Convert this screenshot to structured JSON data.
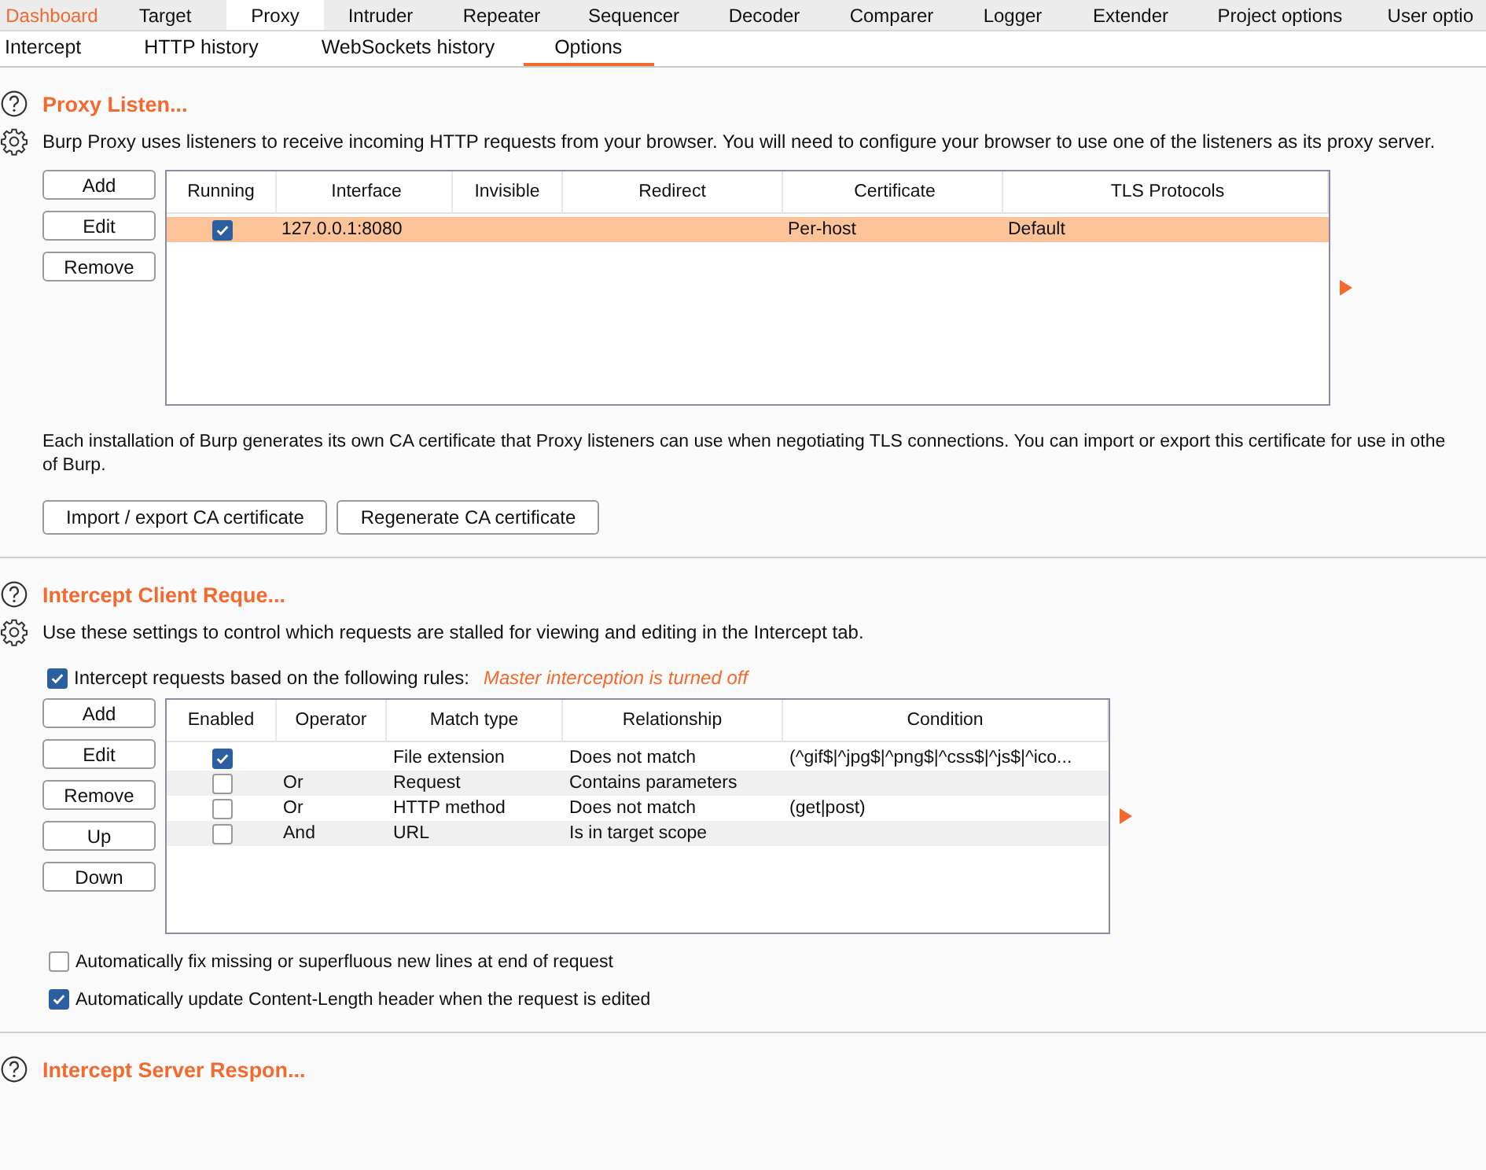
{
  "main_tabs": [
    {
      "label": "Dashboard",
      "selected": false,
      "highlight": true
    },
    {
      "label": "Target",
      "selected": false,
      "highlight": false
    },
    {
      "label": "Proxy",
      "selected": true,
      "highlight": false
    },
    {
      "label": "Intruder",
      "selected": false,
      "highlight": false
    },
    {
      "label": "Repeater",
      "selected": false,
      "highlight": false
    },
    {
      "label": "Sequencer",
      "selected": false,
      "highlight": false
    },
    {
      "label": "Decoder",
      "selected": false,
      "highlight": false
    },
    {
      "label": "Comparer",
      "selected": false,
      "highlight": false
    },
    {
      "label": "Logger",
      "selected": false,
      "highlight": false
    },
    {
      "label": "Extender",
      "selected": false,
      "highlight": false
    },
    {
      "label": "Project options",
      "selected": false,
      "highlight": false
    },
    {
      "label": "User optio",
      "selected": false,
      "highlight": false
    }
  ],
  "sub_tabs": [
    {
      "label": "Intercept",
      "selected": false
    },
    {
      "label": "HTTP history",
      "selected": false
    },
    {
      "label": "WebSockets history",
      "selected": false
    },
    {
      "label": "Options",
      "selected": true
    }
  ],
  "proxy_listeners": {
    "title": "Proxy Listen...",
    "description": "Burp Proxy uses listeners to receive incoming HTTP requests from your browser. You will need to configure your browser to use one of the listeners as its proxy server.",
    "buttons": [
      "Add",
      "Edit",
      "Remove"
    ],
    "columns": [
      "Running",
      "Interface",
      "Invisible",
      "Redirect",
      "Certificate",
      "TLS Protocols"
    ],
    "rows": [
      {
        "running": true,
        "interface": "127.0.0.1:8080",
        "certificate": "Per-host",
        "tls_protocols": "Default",
        "selected": true
      }
    ],
    "note_lines": [
      "Each installation of Burp generates its own CA certificate that Proxy listeners can use when negotiating TLS connections. You can import or export this certificate for use in othe",
      "of Burp."
    ],
    "actions": [
      "Import / export CA certificate",
      "Regenerate CA certificate"
    ]
  },
  "intercept_client_requests": {
    "title": "Intercept Client Reque...",
    "description": "Use these settings to control which requests are stalled for viewing and editing in the Intercept tab.",
    "rules_toggle": {
      "label": "Intercept requests based on the following rules:",
      "checked": true,
      "status": "Master interception is turned off"
    },
    "buttons": [
      "Add",
      "Edit",
      "Remove",
      "Up",
      "Down"
    ],
    "columns": [
      "Enabled",
      "Operator",
      "Match type",
      "Relationship",
      "Condition"
    ],
    "rows": [
      {
        "enabled": true,
        "match_type": "File extension",
        "relationship": "Does not match",
        "condition": "(^gif$|^jpg$|^png$|^css$|^js$|^ico..."
      },
      {
        "enabled": false,
        "operator": "Or",
        "match_type": "Request",
        "relationship": "Contains parameters"
      },
      {
        "enabled": false,
        "operator": "Or",
        "match_type": "HTTP method",
        "relationship": "Does not match",
        "condition": "(get|post)"
      },
      {
        "enabled": false,
        "operator": "And",
        "match_type": "URL",
        "relationship": "Is in target scope"
      }
    ],
    "options": [
      {
        "label": "Automatically fix missing or superfluous new lines at end of request",
        "checked": false
      },
      {
        "label": "Automatically update Content-Length header when the request is edited",
        "checked": true
      }
    ]
  },
  "intercept_server_responses": {
    "title": "Intercept Server Respon..."
  }
}
